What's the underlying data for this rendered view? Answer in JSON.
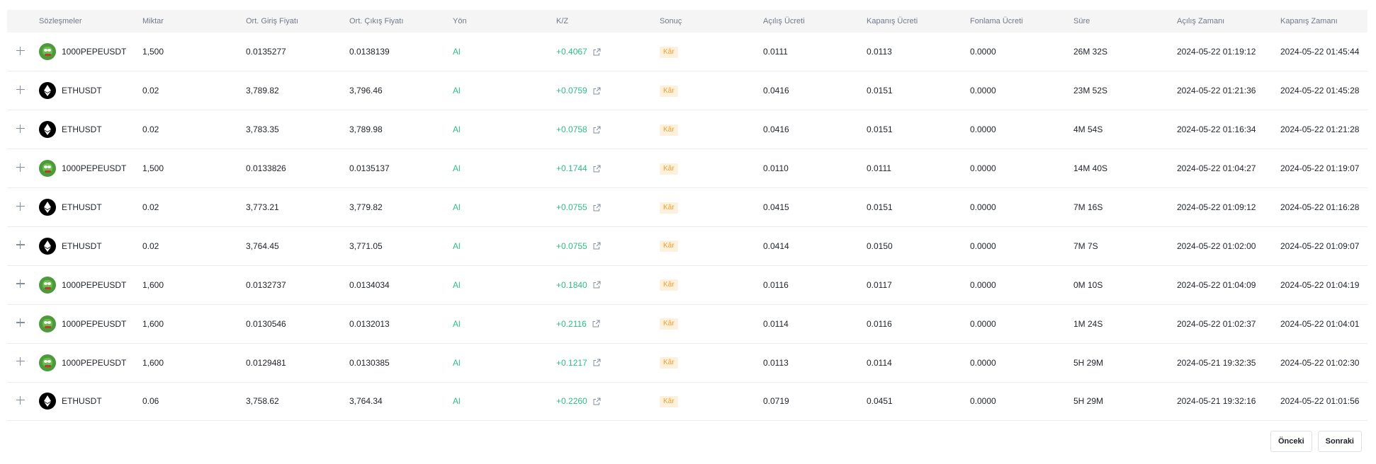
{
  "table": {
    "headers": [
      "",
      "Sözleşmeler",
      "Miktar",
      "Ort. Giriş Fiyatı",
      "Ort. Çıkış Fiyatı",
      "Yön",
      "K/Z",
      "Sonuç",
      "Açılış Ücreti",
      "Kapanış Ücreti",
      "Fonlama Ücreti",
      "Süre",
      "Açılış Zamanı",
      "Kapanış Zamanı"
    ],
    "rows": [
      {
        "coin_icon": "pepe-icon",
        "symbol": "1000PEPEUSDT",
        "qty": "1,500",
        "entry": "0.0135277",
        "exit": "0.0138139",
        "side": "Al",
        "pnl": "+0.4067",
        "result": "Kâr",
        "open_fee": "0.0111",
        "close_fee": "0.0113",
        "funding_fee": "0.0000",
        "duration": "26M 32S",
        "open_time": "2024-05-22 01:19:12",
        "close_time": "2024-05-22 01:45:44"
      },
      {
        "coin_icon": "eth-icon",
        "symbol": "ETHUSDT",
        "qty": "0.02",
        "entry": "3,789.82",
        "exit": "3,796.46",
        "side": "Al",
        "pnl": "+0.0759",
        "result": "Kâr",
        "open_fee": "0.0416",
        "close_fee": "0.0151",
        "funding_fee": "0.0000",
        "duration": "23M 52S",
        "open_time": "2024-05-22 01:21:36",
        "close_time": "2024-05-22 01:45:28"
      },
      {
        "coin_icon": "eth-icon",
        "symbol": "ETHUSDT",
        "qty": "0.02",
        "entry": "3,783.35",
        "exit": "3,789.98",
        "side": "Al",
        "pnl": "+0.0758",
        "result": "Kâr",
        "open_fee": "0.0416",
        "close_fee": "0.0151",
        "funding_fee": "0.0000",
        "duration": "4M 54S",
        "open_time": "2024-05-22 01:16:34",
        "close_time": "2024-05-22 01:21:28"
      },
      {
        "coin_icon": "pepe-icon",
        "symbol": "1000PEPEUSDT",
        "qty": "1,500",
        "entry": "0.0133826",
        "exit": "0.0135137",
        "side": "Al",
        "pnl": "+0.1744",
        "result": "Kâr",
        "open_fee": "0.0110",
        "close_fee": "0.0111",
        "funding_fee": "0.0000",
        "duration": "14M 40S",
        "open_time": "2024-05-22 01:04:27",
        "close_time": "2024-05-22 01:19:07"
      },
      {
        "coin_icon": "eth-icon",
        "symbol": "ETHUSDT",
        "qty": "0.02",
        "entry": "3,773.21",
        "exit": "3,779.82",
        "side": "Al",
        "pnl": "+0.0755",
        "result": "Kâr",
        "open_fee": "0.0415",
        "close_fee": "0.0151",
        "funding_fee": "0.0000",
        "duration": "7M 16S",
        "open_time": "2024-05-22 01:09:12",
        "close_time": "2024-05-22 01:16:28"
      },
      {
        "coin_icon": "eth-icon",
        "symbol": "ETHUSDT",
        "qty": "0.02",
        "entry": "3,764.45",
        "exit": "3,771.05",
        "side": "Al",
        "pnl": "+0.0755",
        "result": "Kâr",
        "open_fee": "0.0414",
        "close_fee": "0.0150",
        "funding_fee": "0.0000",
        "duration": "7M 7S",
        "open_time": "2024-05-22 01:02:00",
        "close_time": "2024-05-22 01:09:07"
      },
      {
        "coin_icon": "pepe-icon",
        "symbol": "1000PEPEUSDT",
        "qty": "1,600",
        "entry": "0.0132737",
        "exit": "0.0134034",
        "side": "Al",
        "pnl": "+0.1840",
        "result": "Kâr",
        "open_fee": "0.0116",
        "close_fee": "0.0117",
        "funding_fee": "0.0000",
        "duration": "0M 10S",
        "open_time": "2024-05-22 01:04:09",
        "close_time": "2024-05-22 01:04:19"
      },
      {
        "coin_icon": "pepe-icon",
        "symbol": "1000PEPEUSDT",
        "qty": "1,600",
        "entry": "0.0130546",
        "exit": "0.0132013",
        "side": "Al",
        "pnl": "+0.2116",
        "result": "Kâr",
        "open_fee": "0.0114",
        "close_fee": "0.0116",
        "funding_fee": "0.0000",
        "duration": "1M 24S",
        "open_time": "2024-05-22 01:02:37",
        "close_time": "2024-05-22 01:04:01"
      },
      {
        "coin_icon": "pepe-icon",
        "symbol": "1000PEPEUSDT",
        "qty": "1,600",
        "entry": "0.0129481",
        "exit": "0.0130385",
        "side": "Al",
        "pnl": "+0.1217",
        "result": "Kâr",
        "open_fee": "0.0113",
        "close_fee": "0.0114",
        "funding_fee": "0.0000",
        "duration": "5H 29M",
        "open_time": "2024-05-21 19:32:35",
        "close_time": "2024-05-22 01:02:30"
      },
      {
        "coin_icon": "eth-icon",
        "symbol": "ETHUSDT",
        "qty": "0.06",
        "entry": "3,758.62",
        "exit": "3,764.34",
        "side": "Al",
        "pnl": "+0.2260",
        "result": "Kâr",
        "open_fee": "0.0719",
        "close_fee": "0.0451",
        "funding_fee": "0.0000",
        "duration": "5H 29M",
        "open_time": "2024-05-21 19:32:16",
        "close_time": "2024-05-22 01:01:56"
      }
    ]
  },
  "pagination": {
    "prev_label": "Önceki",
    "next_label": "Sonraki"
  },
  "colors": {
    "profit": "#2ebd85",
    "badge_bg": "#fdf0dc",
    "badge_text": "#f0a02d",
    "header_bg": "#f5f5f5"
  }
}
